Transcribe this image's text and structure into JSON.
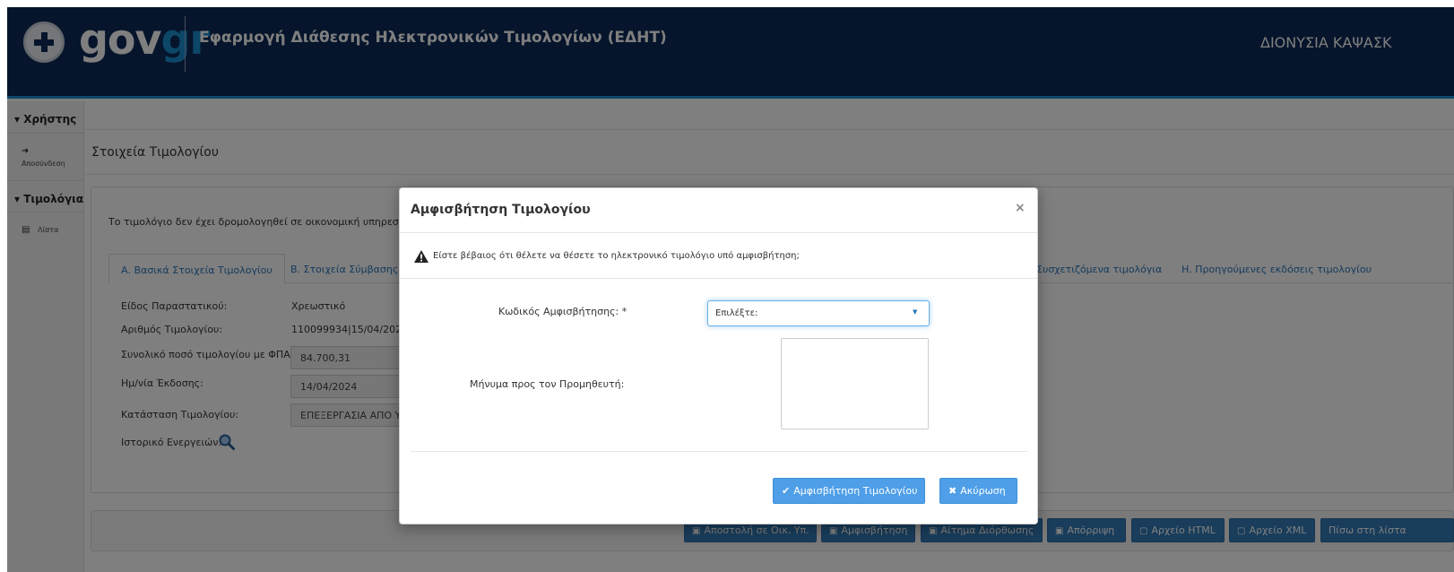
{
  "header": {
    "logo_gov": "gov",
    "logo_gr": "gr",
    "app_title": "Εφαρμογή Διάθεσης Ηλεκτρονικών Τιμολογίων (ΕΔΗΤ)",
    "user_name": "ΔΙΟΝΥΣΙΑ ΚΑΨΑΣΚ"
  },
  "sidebar": {
    "sections": [
      {
        "title": "▾ Χρήστης",
        "items": [
          {
            "label": "Αποσύνδεση",
            "icon": "sign-out-icon"
          }
        ]
      },
      {
        "title": "▾ Τιμολόγια",
        "items": [
          {
            "label": "Λίστα",
            "icon": "document-icon"
          }
        ]
      }
    ]
  },
  "page": {
    "title": "Στοιχεία Τιμολογίου",
    "notice": "Το τιμολόγιο δεν έχει δρομολογηθεί σε οικονομική υπηρεσία"
  },
  "tabs": [
    "Α. Βασικά Στοιχεία Τιμολογίου",
    "Β. Στοιχεία Σύμβασης",
    "Συσχετιζόμενα τιμολόγια",
    "Η. Προηγούμενες εκδόσεις τιμολογίου"
  ],
  "fields": {
    "doc_type_label": "Είδος Παραστατικού:",
    "doc_type_value": "Χρεωστικό",
    "invoice_no_label": "Αριθμός Τιμολογίου:",
    "invoice_no_value": "110099934|15/04/2024",
    "total_label": "Συνολικό ποσό τιμολογίου με ΦΠΑ:",
    "total_value": "84.700,31",
    "issue_date_label": "Ημ/νία Έκδοσης:",
    "issue_date_value": "14/04/2024",
    "status_label": "Κατάσταση Τιμολογίου:",
    "status_value": "ΕΠΕΞΕΡΓΑΣΙΑ ΑΠΟ Υ",
    "history_label": "Ιστορικό Ενεργειών:"
  },
  "toolbar": {
    "buttons": [
      "Αποστολή σε Οικ. Υπ.",
      "Αμφισβήτηση",
      "Αίτημα Διόρθωσης",
      "Απόρριψη",
      "Αρχείο HTML",
      "Αρχείο XML",
      "Πίσω στη λίστα"
    ]
  },
  "modal": {
    "title": "Αμφισβήτηση Τιμολογίου",
    "close": "×",
    "warning": "Είστε βέβαιος ότι θέλετε να θέσετε το ηλεκτρονικό τιμολόγιο υπό αμφισβήτηση;",
    "code_label": "Κωδικός Αμφισβήτησης: *",
    "code_placeholder": "Επιλέξτε:",
    "message_label": "Μήνυμα προς τον Προμηθευτή:",
    "confirm_button": "Αμφισβήτηση Τιμολογίου",
    "cancel_button": "Ακύρωση"
  }
}
